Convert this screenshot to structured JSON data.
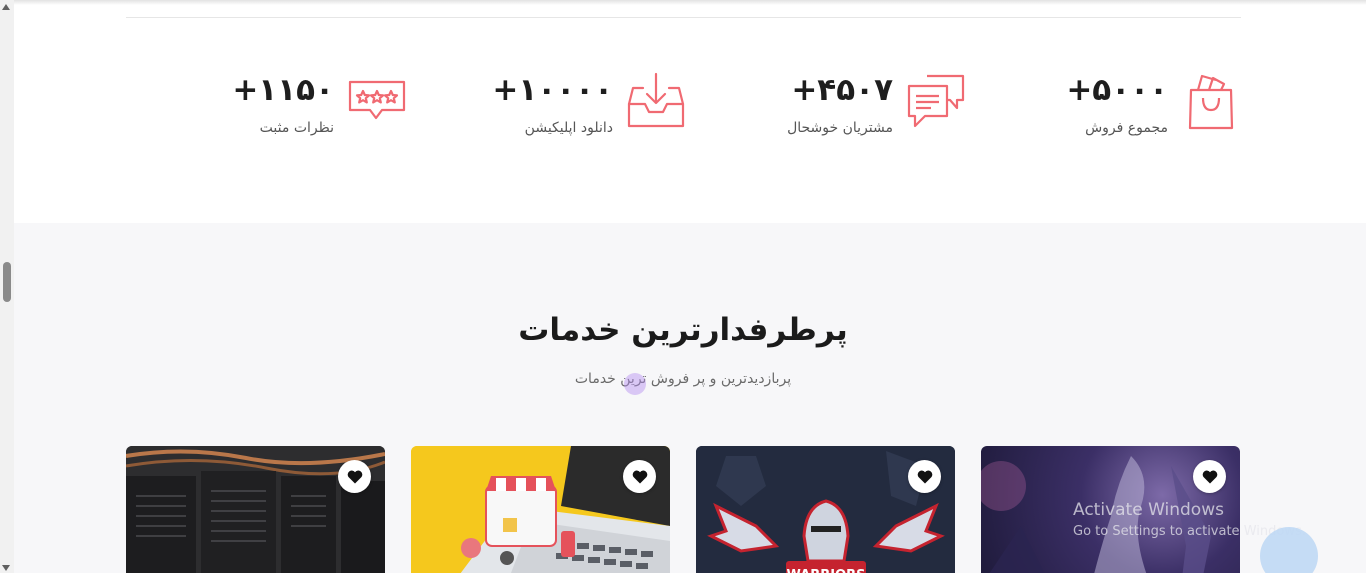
{
  "stats": [
    {
      "number": "+۵۰۰۰",
      "label": "مجموع فروش",
      "icon": "shopping-bag-icon"
    },
    {
      "number": "+۴۵۰۷",
      "label": "مشتریان خوشحال",
      "icon": "chat-bubbles-icon"
    },
    {
      "number": "+۱۰۰۰۰",
      "label": "دانلود اپلیکیشن",
      "icon": "download-tray-icon"
    },
    {
      "number": "+۱۱۵۰",
      "label": "نظرات مثبت",
      "icon": "rating-stars-icon"
    }
  ],
  "services": {
    "title": "پرطرفدارترین خدمات",
    "subtitle": "پربازدیدترین و پر فروش ترین خدمات",
    "cards": [
      {
        "image": "game-character-art",
        "favorite_icon": "heart-icon"
      },
      {
        "image": "warriors-esports-logo",
        "favorite_icon": "heart-icon"
      },
      {
        "image": "online-shop-laptop",
        "favorite_icon": "heart-icon"
      },
      {
        "image": "server-racks",
        "favorite_icon": "heart-icon"
      }
    ]
  },
  "watermark": {
    "line1": "Activate Windows",
    "line2": "Go to Settings to activate Windows."
  },
  "colors": {
    "accent": "#f06a72",
    "section_bg": "#f7f7f9"
  }
}
